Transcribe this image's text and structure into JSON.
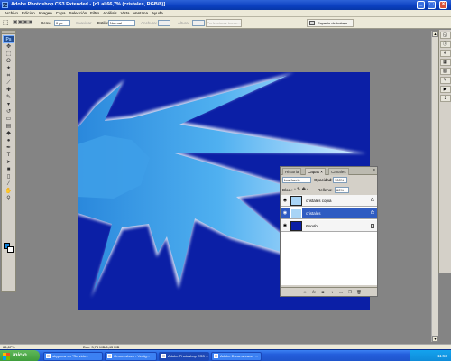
{
  "window": {
    "title": "Adobe Photoshop CS3 Extended - [c1 al 66,7% (cristales, RGB/8)]",
    "app_icon": "Ps",
    "minimize_label": "_",
    "maximize_label": "□",
    "close_label": "×"
  },
  "menubar": {
    "items": [
      "Archivo",
      "Edición",
      "Imagen",
      "Capa",
      "Selección",
      "Filtro",
      "Análisis",
      "Vista",
      "Ventana",
      "Ayuda"
    ]
  },
  "options": {
    "feather_label": "Desv.:",
    "feather_value": "0 px",
    "smooth_label": "Suavizar",
    "style_label": "Estilo:",
    "style_value": "Normal",
    "width_label": "Anchura:",
    "height_label": "Altura:",
    "refine_button": "Perfeccionar borde...",
    "workspace_button": "Espacio de trabajo"
  },
  "toolbox": {
    "logo": "Ps",
    "tools": [
      {
        "name": "move-tool-icon",
        "glyph": "✥"
      },
      {
        "name": "marquee-tool-icon",
        "glyph": "⬚"
      },
      {
        "name": "lasso-tool-icon",
        "glyph": "ʘ"
      },
      {
        "name": "quick-select-tool-icon",
        "glyph": "✦"
      },
      {
        "name": "crop-tool-icon",
        "glyph": "⌗"
      },
      {
        "name": "slice-tool-icon",
        "glyph": "⟋"
      },
      {
        "name": "healing-brush-icon",
        "glyph": "✚"
      },
      {
        "name": "brush-tool-icon",
        "glyph": "✎"
      },
      {
        "name": "stamp-tool-icon",
        "glyph": "▾"
      },
      {
        "name": "history-brush-icon",
        "glyph": "↺"
      },
      {
        "name": "eraser-tool-icon",
        "glyph": "▭"
      },
      {
        "name": "gradient-tool-icon",
        "glyph": "▤"
      },
      {
        "name": "blur-tool-icon",
        "glyph": "◆"
      },
      {
        "name": "dodge-tool-icon",
        "glyph": "●"
      },
      {
        "name": "pen-tool-icon",
        "glyph": "✒"
      },
      {
        "name": "type-tool-icon",
        "glyph": "T"
      },
      {
        "name": "path-select-tool-icon",
        "glyph": "➤"
      },
      {
        "name": "shape-tool-icon",
        "glyph": "■"
      },
      {
        "name": "notes-tool-icon",
        "glyph": "▯"
      },
      {
        "name": "eyedropper-tool-icon",
        "glyph": "⁄"
      },
      {
        "name": "hand-tool-icon",
        "glyph": "✋"
      },
      {
        "name": "zoom-tool-icon",
        "glyph": "⚲"
      }
    ]
  },
  "layers_panel": {
    "tabs": [
      "Historia",
      "Capas ×",
      "Canales"
    ],
    "blend_mode": "Luz fuerte",
    "opacity_label": "Opacidad:",
    "opacity_value": "100%",
    "lock_label": "Bloq.:",
    "fill_label": "Relleno:",
    "fill_value": "60%",
    "layers": [
      {
        "name": "cristales copia",
        "badge": "fx"
      },
      {
        "name": "cristales",
        "badge": "fx"
      },
      {
        "name": "Fondo",
        "badge": ""
      }
    ],
    "footer_icons": [
      "link-layers-icon",
      "fx-icon",
      "mask-icon",
      "adjustment-icon",
      "group-icon",
      "new-layer-icon",
      "trash-icon"
    ]
  },
  "status": {
    "zoom": "66,67%",
    "doc": "Doc: 3,75 MB/6,43 MB"
  },
  "taskbar": {
    "start_label": "Inicio",
    "tasks": [
      "skypcow en \"Servido...",
      "Grooveshark - Vertig...",
      "Adobe Photoshop CS3 ...",
      "Adobe Dreamweaver ..."
    ],
    "clock": "11:58"
  },
  "colors": {
    "canvas_bg": "#0b1fa6",
    "crystal": "#3a9ae6",
    "selected_layer": "#2f5cc2"
  }
}
